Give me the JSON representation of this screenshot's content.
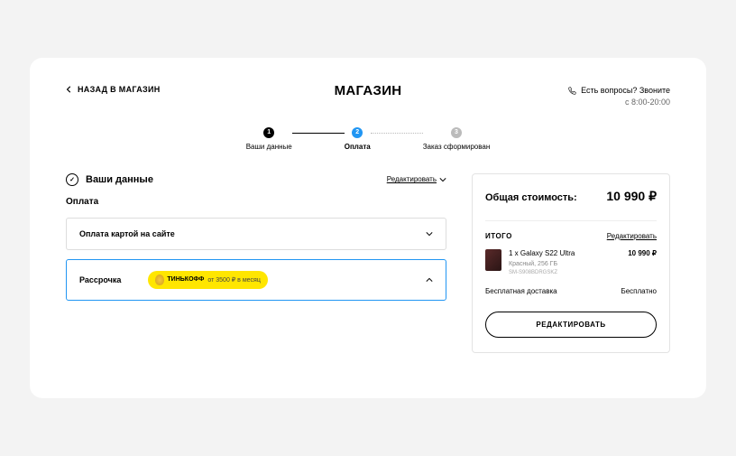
{
  "header": {
    "back_label": "НАЗАД В МАГАЗИН",
    "logo": "МАГАЗИН",
    "help_line1": "Есть вопросы? Звоните",
    "help_line2": "с 8:00-20:00"
  },
  "steps": {
    "s1": {
      "num": "1",
      "label": "Ваши данные"
    },
    "s2": {
      "num": "2",
      "label": "Оплата"
    },
    "s3": {
      "num": "3",
      "label": "Заказ сформирован"
    }
  },
  "left": {
    "section_title": "Ваши данные",
    "edit_label": "Редактировать",
    "pay_title": "Оплата",
    "option1": "Оплата картой на сайте",
    "option2": "Рассрочка",
    "bank_name": "ТИНЬКОФФ",
    "bank_offer": "от 3500 ₽ в месяц"
  },
  "summary": {
    "total_label": "Общая стоимость:",
    "total_value": "10 990 ₽",
    "itogo": "ИТОГО",
    "itogo_edit": "Редактировать",
    "product_name": "1 x Galaxy S22 Ultra",
    "product_sub": "Красный, 256 ГБ",
    "product_sku": "SM-S908BDRGSKZ",
    "product_price": "10 990 ₽",
    "delivery_label": "Бесплатная доставка",
    "delivery_value": "Бесплатно",
    "edit_button": "РЕДАКТИРОВАТЬ"
  }
}
